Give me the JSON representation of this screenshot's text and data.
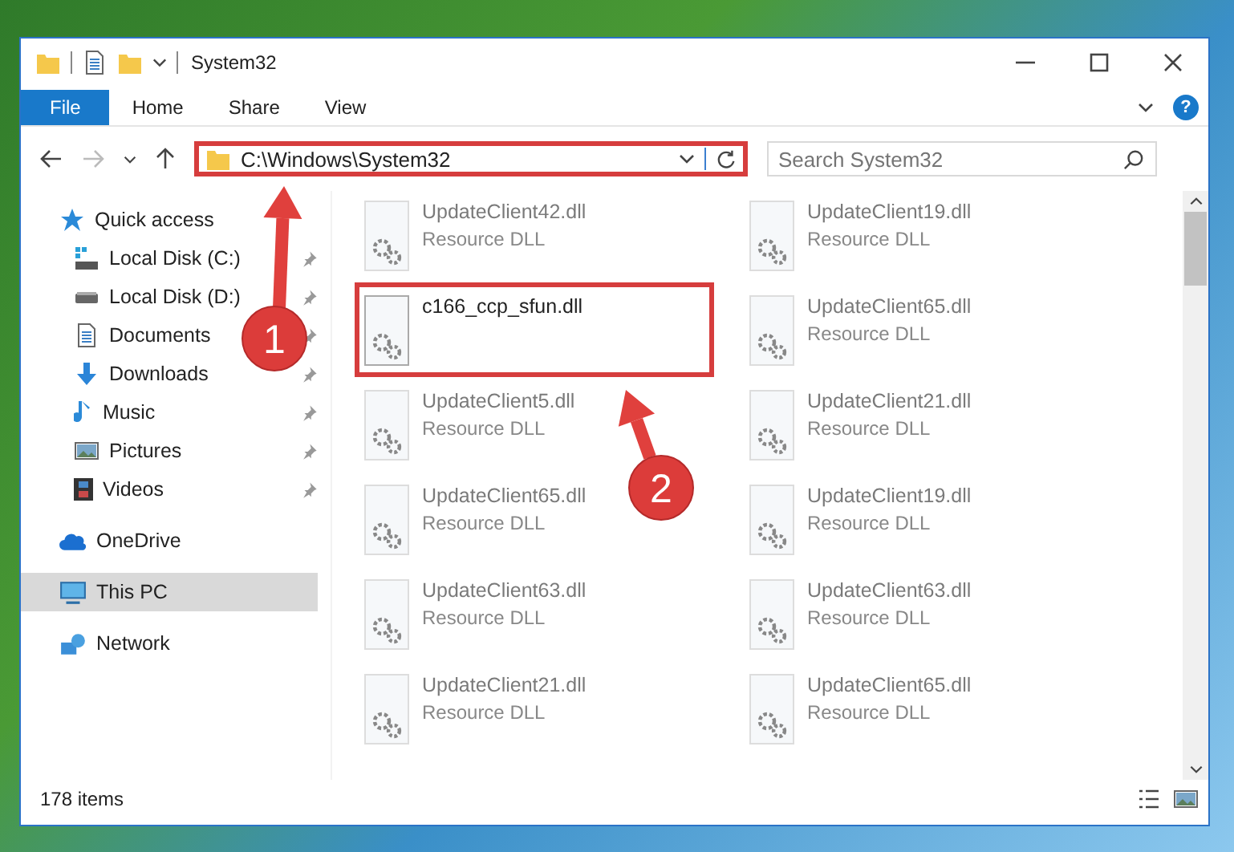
{
  "window": {
    "title": "System32"
  },
  "ribbon": {
    "tabs": [
      {
        "label": "File",
        "selected": true
      },
      {
        "label": "Home",
        "selected": false
      },
      {
        "label": "Share",
        "selected": false
      },
      {
        "label": "View",
        "selected": false
      }
    ],
    "help": "?"
  },
  "address_bar": {
    "path": "C:\\Windows\\System32",
    "highlighted": true
  },
  "search": {
    "placeholder": "Search System32"
  },
  "sidebar": {
    "items": [
      {
        "label": "Quick access",
        "pinned": false,
        "selected": false,
        "children": [
          {
            "label": "Local Disk (C:)",
            "pinned": true,
            "selected": false
          },
          {
            "label": "Local Disk (D:)",
            "pinned": true,
            "selected": false
          },
          {
            "label": "Documents",
            "pinned": true,
            "selected": false
          },
          {
            "label": "Downloads",
            "pinned": true,
            "selected": false
          },
          {
            "label": "Music",
            "pinned": true,
            "selected": false
          },
          {
            "label": "Pictures",
            "pinned": true,
            "selected": false
          },
          {
            "label": "Videos",
            "pinned": true,
            "selected": false
          }
        ]
      },
      {
        "label": "OneDrive",
        "pinned": false,
        "selected": false
      },
      {
        "label": "This PC",
        "pinned": false,
        "selected": true
      },
      {
        "label": "Network",
        "pinned": false,
        "selected": false
      }
    ]
  },
  "files": [
    {
      "name": "UpdateClient42.dll",
      "type": "Resource DLL",
      "faded": true,
      "highlighted": false
    },
    {
      "name": "UpdateClient19.dll",
      "type": "Resource DLL",
      "faded": true,
      "highlighted": false
    },
    {
      "name": "c166_ccp_sfun.dll",
      "faded": false,
      "highlighted": true
    },
    {
      "name": "UpdateClient65.dll",
      "type": "Resource DLL",
      "faded": true,
      "highlighted": false
    },
    {
      "name": "UpdateClient5.dll",
      "type": "Resource DLL",
      "faded": true,
      "highlighted": false
    },
    {
      "name": "UpdateClient21.dll",
      "type": "Resource DLL",
      "faded": true,
      "highlighted": false
    },
    {
      "name": "UpdateClient65.dll",
      "type": "Resource DLL",
      "faded": true,
      "highlighted": false
    },
    {
      "name": "UpdateClient19.dll",
      "type": "Resource DLL",
      "faded": true,
      "highlighted": false
    },
    {
      "name": "UpdateClient63.dll",
      "type": "Resource DLL",
      "faded": true,
      "highlighted": false
    },
    {
      "name": "UpdateClient63.dll",
      "type": "Resource DLL",
      "faded": true,
      "highlighted": false
    },
    {
      "name": "UpdateClient21.dll",
      "type": "Resource DLL",
      "faded": true,
      "highlighted": false
    },
    {
      "name": "UpdateClient65.dll",
      "type": "Resource DLL",
      "faded": true,
      "highlighted": false
    }
  ],
  "status_bar": {
    "item_count": "178 items"
  },
  "annotations": [
    {
      "label": "1"
    },
    {
      "label": "2"
    }
  ]
}
